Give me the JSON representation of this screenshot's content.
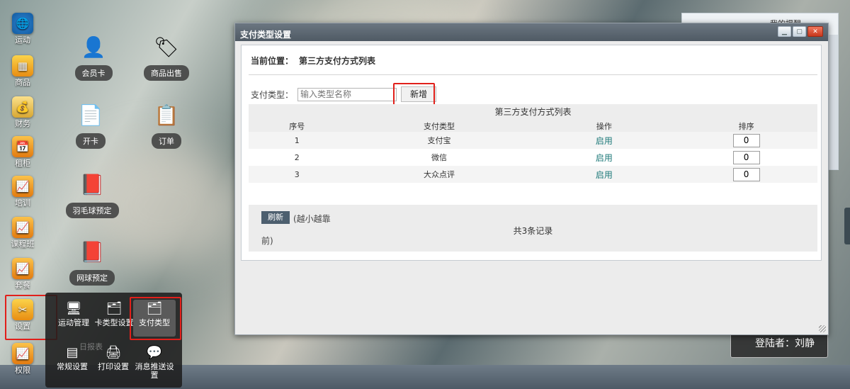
{
  "launcher": [
    {
      "label": "运动",
      "icon": "sport-icon",
      "color": "#f4a020"
    },
    {
      "label": "商品",
      "icon": "goods-icon",
      "color": "#f4a020"
    },
    {
      "label": "财务",
      "icon": "finance-icon",
      "color": "#f4a020"
    },
    {
      "label": "租柜",
      "icon": "locker-icon",
      "color": "#f4a020"
    },
    {
      "label": "培训",
      "icon": "training-icon",
      "color": "#f4a020"
    },
    {
      "label": "课程班",
      "icon": "course-icon",
      "color": "#f4a020"
    },
    {
      "label": "套餐",
      "icon": "package-icon",
      "color": "#f4a020"
    },
    {
      "label": "设置",
      "icon": "settings-icon",
      "color": "#f4a020"
    },
    {
      "label": "权限",
      "icon": "permission-icon",
      "color": "#f4a020"
    }
  ],
  "desktop": {
    "member_card": "会员卡",
    "goods_sale": "商品出售",
    "open_card": "开卡",
    "order": "订单",
    "badminton": "羽毛球预定",
    "tennis": "网球预定"
  },
  "popup": {
    "items": [
      "运动管理",
      "卡类型设置",
      "支付类型",
      "常规设置",
      "打印设置",
      "消息推送设置"
    ],
    "ghost_label": "日报表"
  },
  "reminder": {
    "title": "我的提醒"
  },
  "login": {
    "text": "登陆者：刘静"
  },
  "window": {
    "title": "支付类型设置",
    "breadcrumb_label": "当前位置：",
    "breadcrumb_value": "第三方支付方式列表",
    "filter_label": "支付类型：",
    "filter_placeholder": "输入类型名称",
    "add_button": "新增",
    "table_caption": "第三方支付方式列表",
    "columns": [
      "序号",
      "支付类型",
      "操作",
      "排序"
    ],
    "rows": [
      {
        "no": "1",
        "type": "支付宝",
        "action": "启用",
        "rank": "0"
      },
      {
        "no": "2",
        "type": "微信",
        "action": "启用",
        "rank": "0"
      },
      {
        "no": "3",
        "type": "大众点评",
        "action": "启用",
        "rank": "0"
      }
    ],
    "refresh_button": "刷新",
    "hint_1": "(越小越靠",
    "hint_2": "前)",
    "total": "共3条记录"
  },
  "colors": {
    "highlight": "#e1201b",
    "link": "#1f7a7a"
  }
}
